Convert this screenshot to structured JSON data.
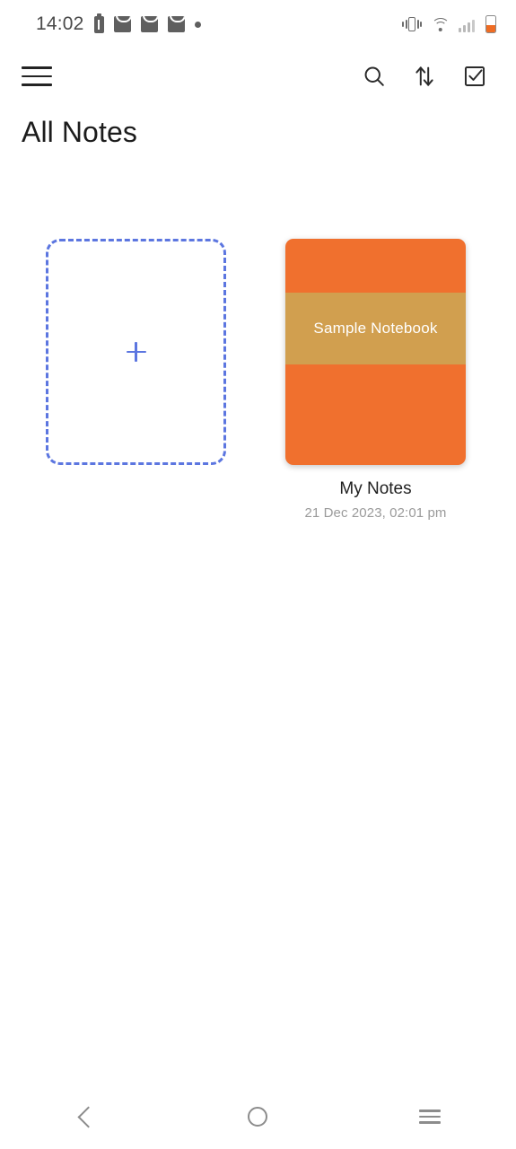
{
  "status_bar": {
    "time": "14:02",
    "left_icons": [
      {
        "name": "battery-alert-icon"
      },
      {
        "name": "mail-icon"
      },
      {
        "name": "mail-icon"
      },
      {
        "name": "mail-icon"
      },
      {
        "name": "notification-dot-icon"
      }
    ],
    "right_icons": [
      {
        "name": "vibrate-icon"
      },
      {
        "name": "wifi-icon"
      },
      {
        "name": "cellular-signal-icon"
      },
      {
        "name": "battery-icon"
      }
    ],
    "battery_color": "#ef6c23"
  },
  "toolbar": {
    "menu_icon": "hamburger-menu-icon",
    "search_icon": "search-icon",
    "sort_icon": "sort-arrows-icon",
    "select_icon": "checkbox-select-icon"
  },
  "header": {
    "title": "All Notes"
  },
  "grid": {
    "add_card": {
      "icon": "plus-icon",
      "accent_color": "#5c76e0"
    },
    "notebooks": [
      {
        "cover_label": "Sample Notebook",
        "title": "My Notes",
        "date": "21 Dec 2023, 02:01 pm",
        "cover_color": "#f0702e",
        "band_color": "#d19f4f"
      }
    ]
  },
  "navbar": {
    "back": "back-icon",
    "home": "home-icon",
    "recents": "recents-icon"
  }
}
